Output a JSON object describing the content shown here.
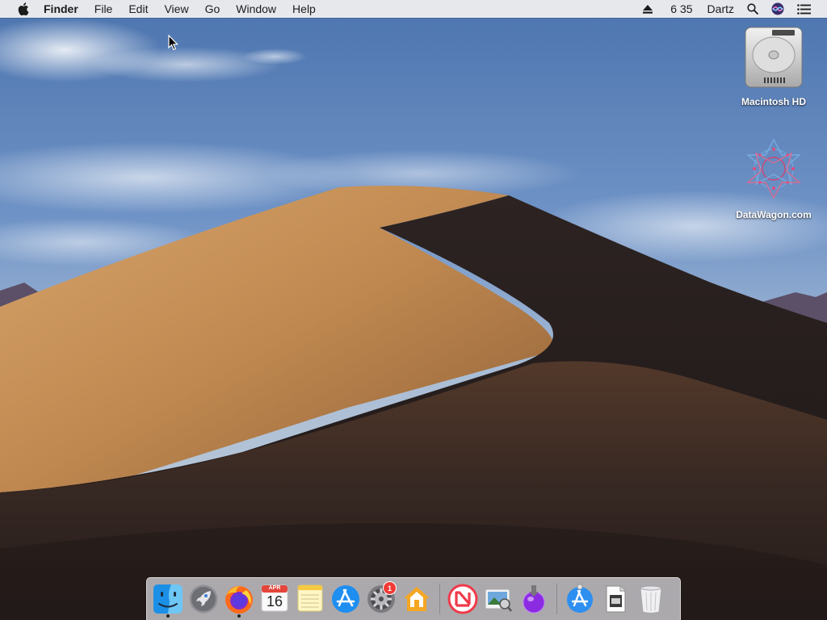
{
  "menubar": {
    "app_name": "Finder",
    "items": [
      "File",
      "Edit",
      "View",
      "Go",
      "Window",
      "Help"
    ],
    "time": "6 35",
    "user": "Dartz"
  },
  "desktop_icons": [
    {
      "label": "Macintosh HD",
      "icon": "hard-drive-icon"
    },
    {
      "label": "DataWagon.com",
      "icon": "mandala-disk-icon"
    }
  ],
  "dock": {
    "calendar_month": "APR",
    "calendar_day": "16",
    "system_prefs_badge": "1",
    "apps": [
      "Finder",
      "Launchpad",
      "Firefox",
      "Calendar",
      "Notes",
      "App Store",
      "System Preferences",
      "Home",
      "News",
      "Preview",
      "Installer",
      "App Store Downloads",
      "Document",
      "Trash"
    ]
  },
  "colors": {
    "menubar_bg": "#ececee",
    "sky": "#5b82bb",
    "dune_light": "#c48d52",
    "dune_shadow": "#2b211f",
    "badge": "#f23a35"
  }
}
